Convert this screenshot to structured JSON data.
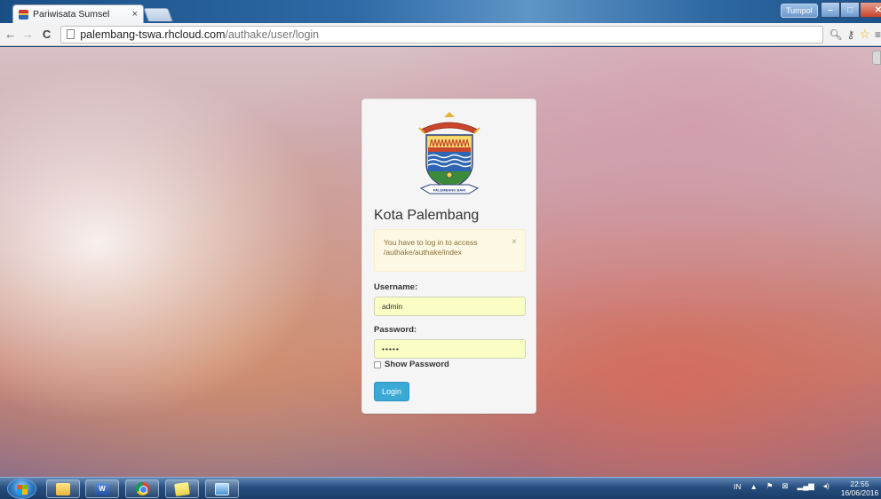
{
  "browser": {
    "tab_title": "Pariwisata Sumsel",
    "tab_close": "×",
    "user_badge": "Tumpol",
    "url_host": "palembang-tswa.rhcloud.com",
    "url_path": "/authake/user/login",
    "window_controls": {
      "minimize": "–",
      "maximize": "□",
      "close": "✕"
    }
  },
  "login": {
    "brand": "Kota Palembang",
    "alert_message": "You have to log in to access /authake/authake/index",
    "alert_close": "×",
    "username_label": "Username:",
    "username_value": "admin",
    "password_label": "Password:",
    "password_value": "•••••",
    "show_password_label": "Show Password",
    "login_button": "Login",
    "logo_ribbon_text": "PALEMBANG BARI"
  },
  "taskbar": {
    "tray_language": "IN",
    "tray_arrow": "▲",
    "clock_time": "22:55",
    "clock_date": "16/06/2016"
  },
  "colors": {
    "button_primary": "#3ba9d6",
    "alert_background": "#fcf8e3",
    "alert_text": "#8a6d3b",
    "input_autofill": "#fafdc4"
  }
}
